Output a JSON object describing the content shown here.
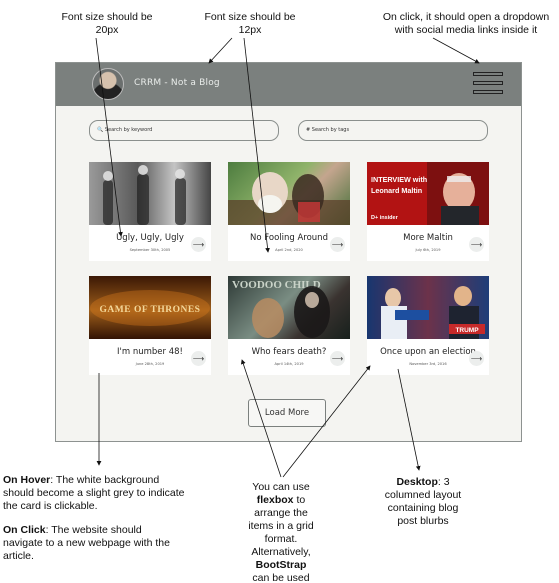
{
  "annotations": {
    "font20": "Font size should be 20px",
    "font12": "Font size should be 12px",
    "dropdown": "On click, it should open a dropdown with social media links inside it",
    "hover_title": "On Hover",
    "hover_text": ": The white background should become a slight grey to indicate the card is clickable.",
    "click_title": "On Click",
    "click_text": ": The website should navigate to a new webpage with the article.",
    "flex_prefix": "You can use",
    "flex_word": "flexbox",
    "flex_mid": "to arrange the items in a grid format. Alternatively,",
    "bootstrap_word": "BootStrap",
    "flex_suffix": "can be used with columns",
    "desktop_title": "Desktop",
    "desktop_text": ": 3 columned layout containing blog post blurbs"
  },
  "header": {
    "site_title": "CRRM - Not a Blog",
    "menu_icon": "hamburger-icon"
  },
  "search": {
    "keyword_placeholder": "🔍 Search by keyword",
    "tags_placeholder": "# Search by tags"
  },
  "cards": [
    {
      "title": "Ugly, Ugly, Ugly",
      "date": "September 30th, 2005",
      "image": "vintage-photo"
    },
    {
      "title": "No Fooling Around",
      "date": "April 2nd, 2020",
      "image": "man-with-monkey"
    },
    {
      "title": "More Maltin",
      "date": "July 6th, 2019",
      "image": "interview-banner",
      "image_text_1": "INTERVIEW with",
      "image_text_2": "Leonard Maltin",
      "image_text_3": "D+ insider"
    },
    {
      "title": "I'm number 48!",
      "date": "June 28th, 2019",
      "image": "game-of-thrones",
      "image_text_1": "GAME OF THRONES"
    },
    {
      "title": "Who fears death?",
      "date": "April 14th, 2019",
      "image": "comic-cover",
      "image_text_1": "VOODOO CHILD"
    },
    {
      "title": "Once upon an election",
      "date": "November 3rd, 2016",
      "image": "election-debate",
      "image_text_1": "TRUMP"
    }
  ],
  "load_more": "Load More"
}
